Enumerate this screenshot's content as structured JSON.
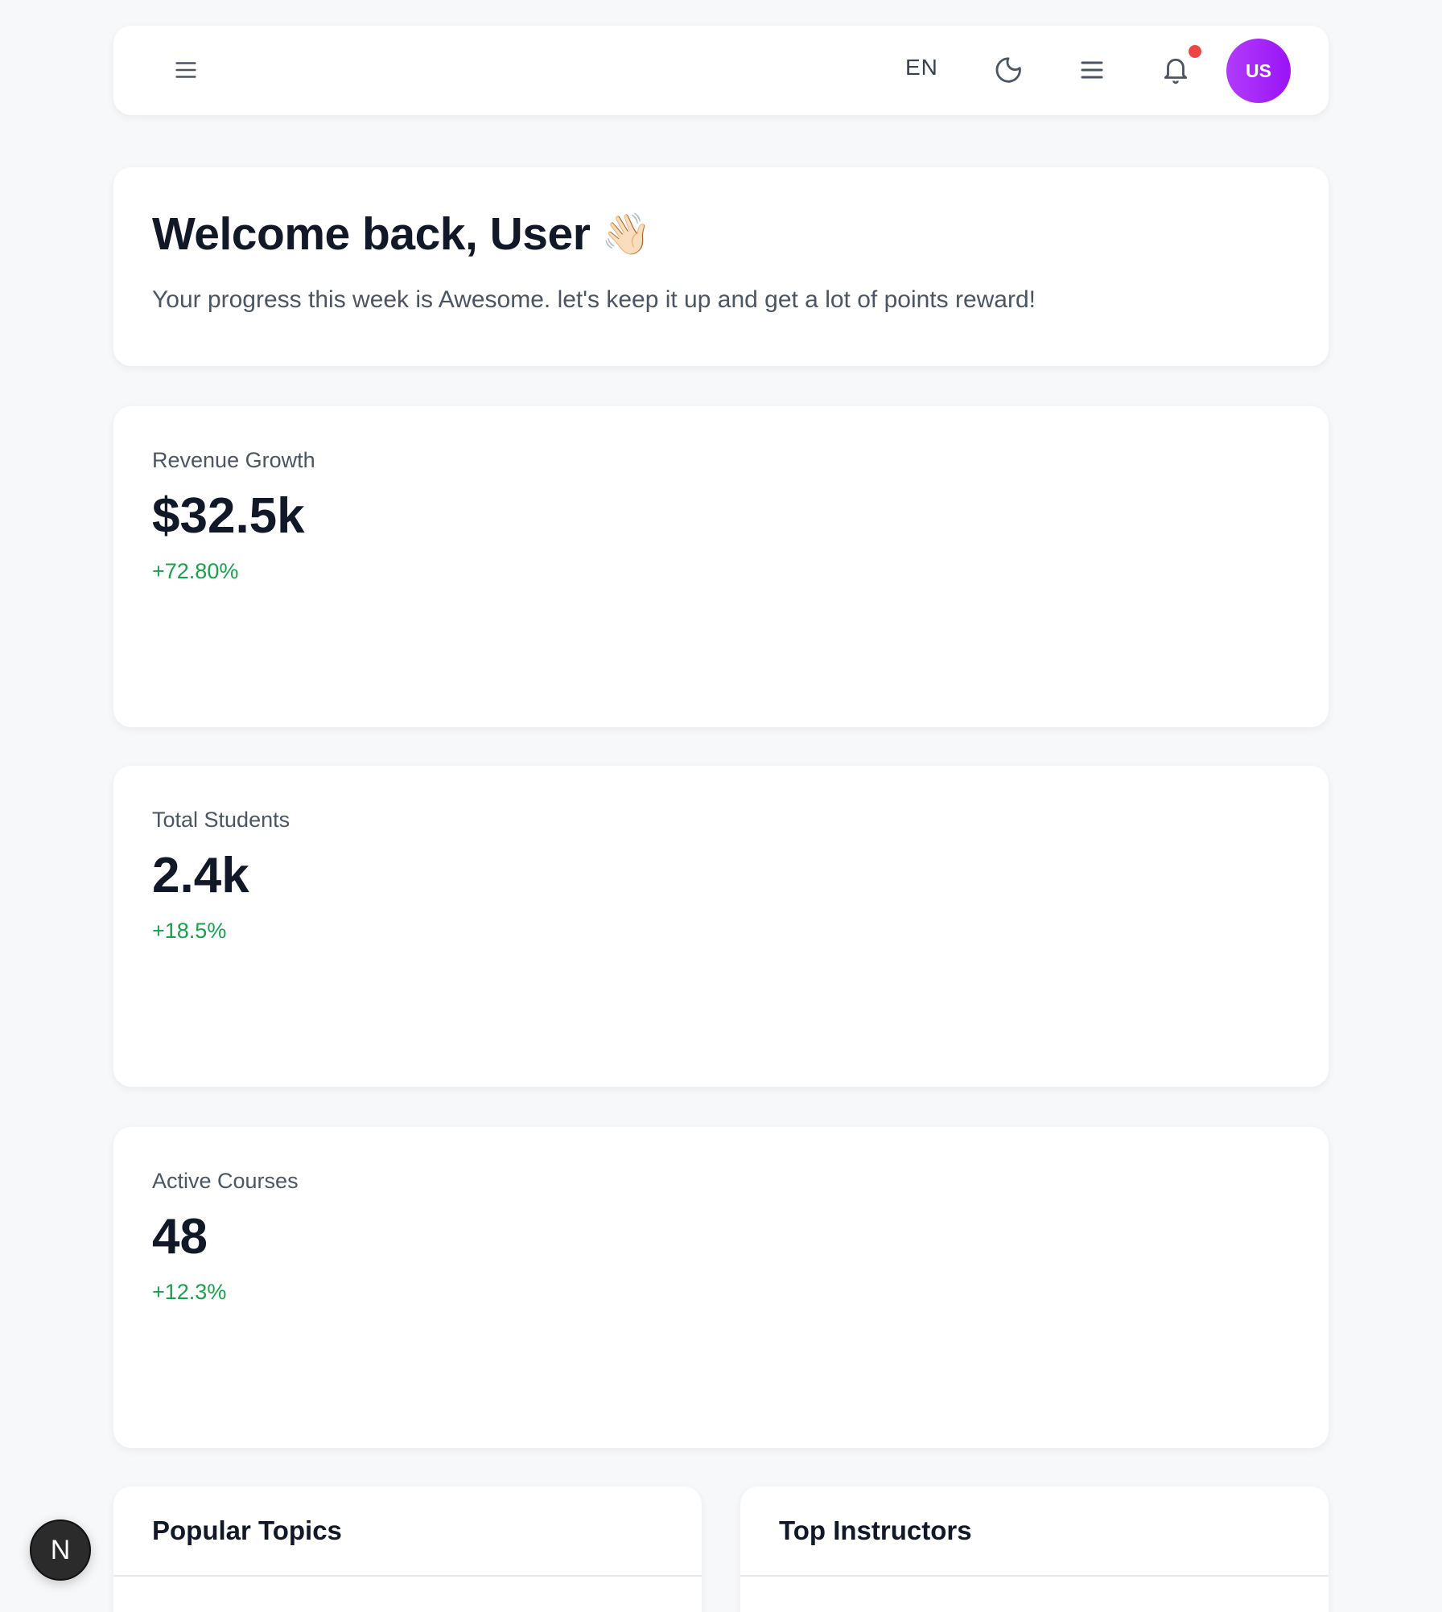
{
  "header": {
    "language": "EN",
    "avatar_initials": "US",
    "icons": [
      "menu-icon",
      "moon-icon",
      "list-icon",
      "bell-icon"
    ],
    "notification_color": "#ef4444"
  },
  "welcome": {
    "title": "Welcome back, User",
    "emoji": "👋🏻",
    "subtitle": "Your progress this week is Awesome. let's keep it up and get a lot of points reward!"
  },
  "stats": [
    {
      "label": "Revenue Growth",
      "value": "$32.5k",
      "change": "+72.80%"
    },
    {
      "label": "Total Students",
      "value": "2.4k",
      "change": "+18.5%"
    },
    {
      "label": "Active Courses",
      "value": "48",
      "change": "+12.3%"
    }
  ],
  "sections": {
    "popular_topics": "Popular Topics",
    "top_instructors": "Top Instructors"
  },
  "badge": {
    "letter": "N"
  },
  "colors": {
    "positive": "#16a34a",
    "avatar": "#a020f0"
  }
}
